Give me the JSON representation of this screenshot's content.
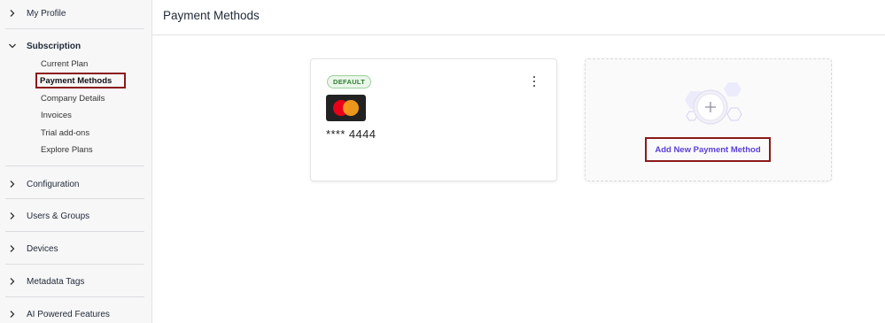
{
  "sidebar": {
    "sections": [
      {
        "label": "My Profile"
      },
      {
        "label": "Subscription",
        "items": [
          "Current Plan",
          "Payment Methods",
          "Company Details",
          "Invoices",
          "Trial add-ons",
          "Explore Plans"
        ]
      },
      {
        "label": "Configuration"
      },
      {
        "label": "Users & Groups"
      },
      {
        "label": "Devices"
      },
      {
        "label": "Metadata Tags"
      },
      {
        "label": "AI Powered Features"
      }
    ],
    "active_item": "Payment Methods"
  },
  "header": {
    "title": "Payment Methods"
  },
  "payment_card": {
    "badge": "DEFAULT",
    "brand_icon": "mastercard-icon",
    "number": "**** 4444"
  },
  "add_card": {
    "button_label": "Add New Payment Method",
    "icon": "plus-icon"
  },
  "colors": {
    "accent": "#5b3fd6",
    "highlight_border": "#8b1a1a",
    "badge_green": "#2e7d32",
    "mastercard_red": "#eb001b",
    "mastercard_orange": "#f79e1b"
  }
}
